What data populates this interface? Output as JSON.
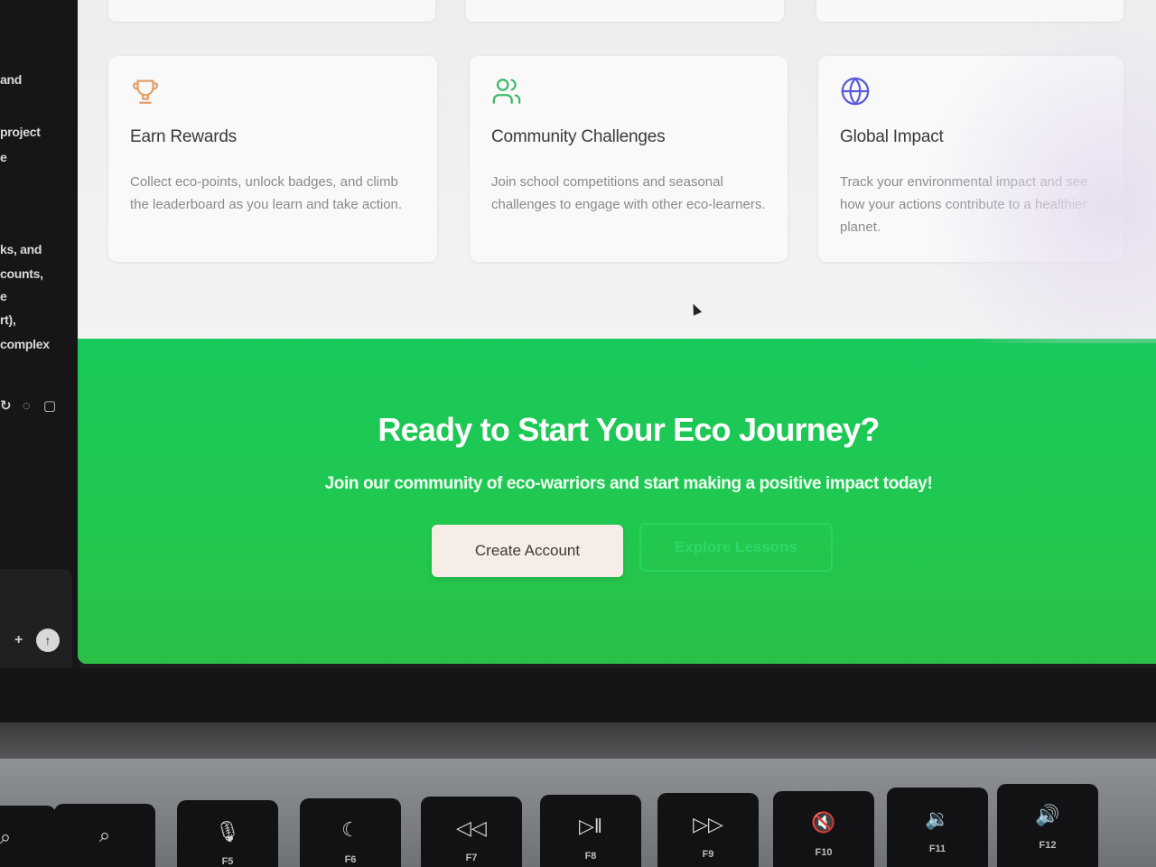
{
  "sidebar": {
    "fragments": [
      "and",
      "project",
      "e",
      "ks, and",
      "counts,",
      "e",
      "rt),",
      "complex"
    ],
    "icons": [
      "sync-icon",
      "thumbs-down-icon",
      "copy-icon"
    ],
    "plus_label": "+",
    "send_label": "↑"
  },
  "features": [
    {
      "icon": "trophy-icon",
      "icon_color": "#e3a06a",
      "title": "Earn Rewards",
      "description": "Collect eco-points, unlock badges, and climb the leaderboard as you learn and take action."
    },
    {
      "icon": "users-icon",
      "icon_color": "#3cb96a",
      "title": "Community Challenges",
      "description": "Join school competitions and seasonal challenges to engage with other eco-learners."
    },
    {
      "icon": "globe-icon",
      "icon_color": "#5b5bd6",
      "title": "Global Impact",
      "description": "Track your environmental impact and see how your actions contribute to a healthier planet."
    }
  ],
  "cta": {
    "heading": "Ready to Start Your Eco Journey?",
    "subheading": "Join our community of eco-warriors and start making a positive impact today!",
    "primary_button": "Create Account",
    "secondary_button": "Explore Lessons",
    "background_color": "#1fc857"
  },
  "keyboard": {
    "keys": [
      {
        "symbol": "⌕",
        "label": ""
      },
      {
        "symbol": "🎙",
        "label": "F5"
      },
      {
        "symbol": "☾",
        "label": "F6"
      },
      {
        "symbol": "◁◁",
        "label": "F7"
      },
      {
        "symbol": "▷‖",
        "label": "F8"
      },
      {
        "symbol": "▷▷",
        "label": "F9"
      },
      {
        "symbol": "🔇",
        "label": "F10"
      },
      {
        "symbol": "🔉",
        "label": "F11"
      },
      {
        "symbol": "🔊",
        "label": "F12"
      }
    ]
  }
}
